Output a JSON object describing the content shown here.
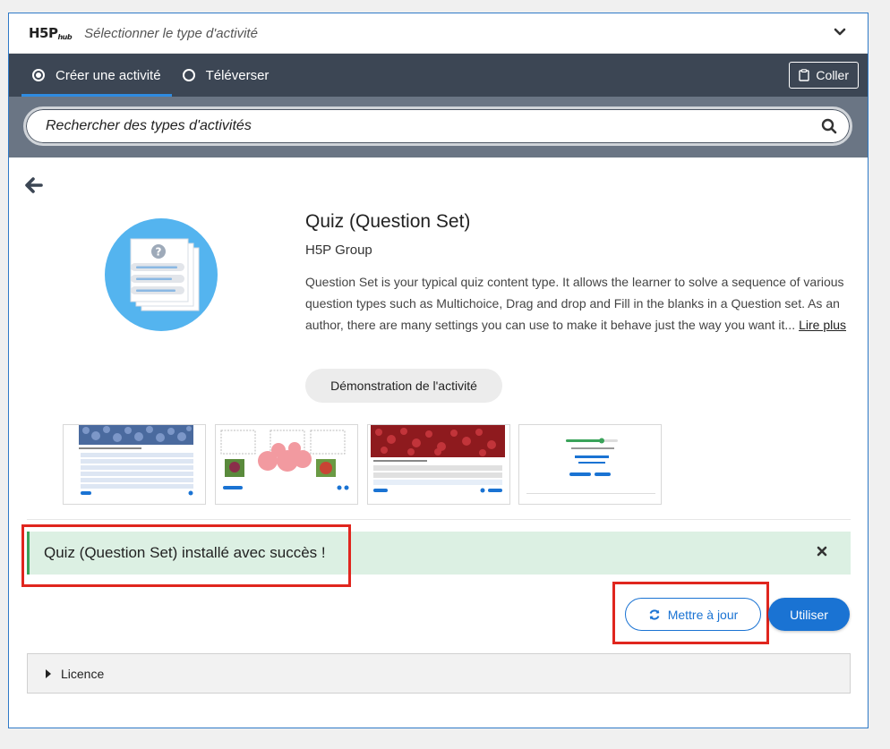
{
  "header": {
    "logo_text": "H5P",
    "logo_sub": "hub",
    "title": "Sélectionner le type d'activité"
  },
  "tabs": [
    {
      "label": "Créer une activité",
      "selected": true
    },
    {
      "label": "Téléverser",
      "selected": false
    }
  ],
  "paste_label": "Coller",
  "search": {
    "placeholder": "Rechercher des types d'activités"
  },
  "detail": {
    "title": "Quiz (Question Set)",
    "owner": "H5P Group",
    "description": "Question Set is your typical quiz content type. It allows the learner to solve a sequence of various question types such as Multichoice, Drag and drop and Fill in the blanks in a Question set. As an author, there are many settings you can use to make it behave just the way you want it...",
    "read_more": "Lire plus",
    "demo_label": "Démonstration de l'activité"
  },
  "success_message": "Quiz (Question Set) installé avec succès !",
  "update_label": "Mettre à jour",
  "use_label": "Utiliser",
  "license_label": "Licence",
  "colors": {
    "accent": "#1a73d3",
    "tabbar": "#3c4654",
    "searchbar": "#6a7584",
    "success_bg": "#dcf0e3",
    "highlight": "#e0261e"
  }
}
